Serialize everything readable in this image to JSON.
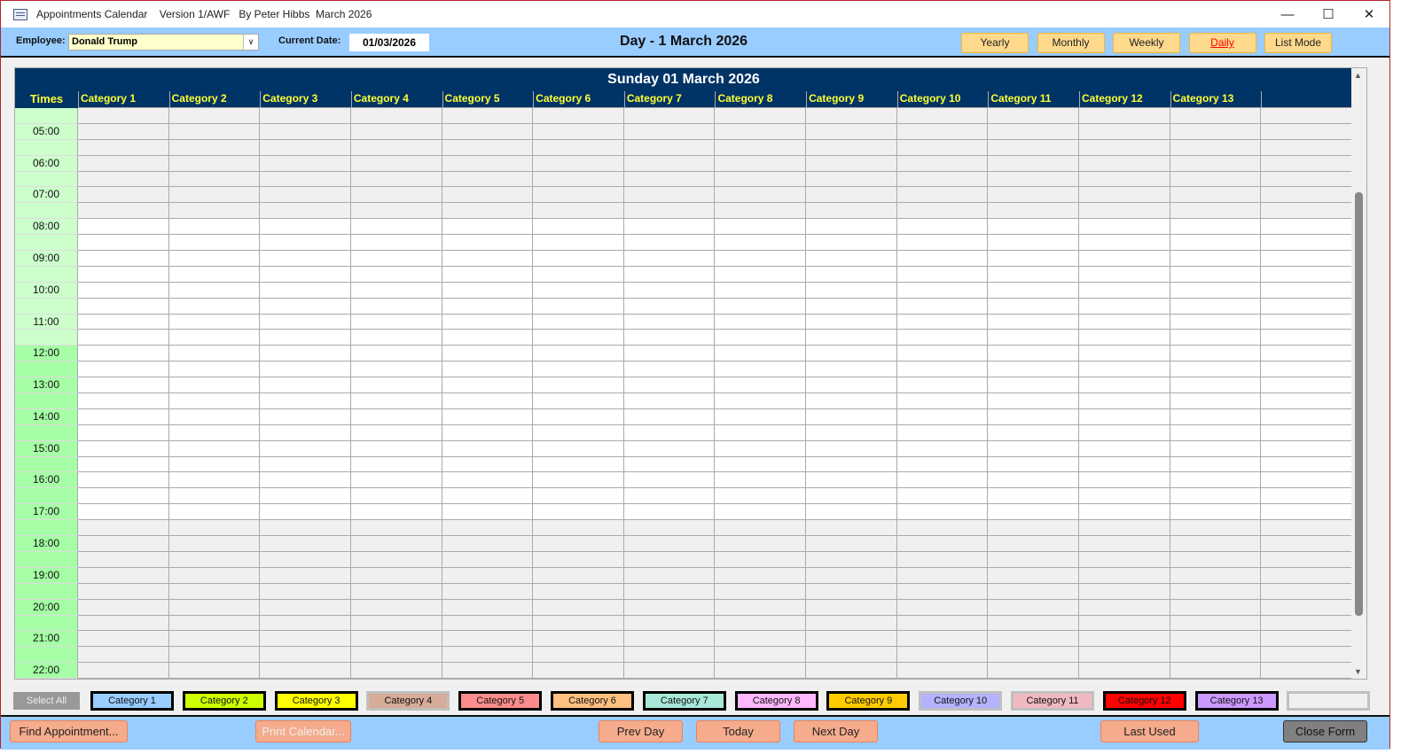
{
  "window": {
    "title": "Appointments Calendar    Version 1/AWF   By Peter Hibbs  March 2026",
    "minimize": "—",
    "maximize": "☐",
    "close": "✕"
  },
  "header": {
    "employee_label": "Employee:",
    "employee_value": "Donald Trump",
    "date_label": "Current Date:",
    "date_value": "01/03/2026",
    "day_title": "Day - 1 March 2026",
    "views": [
      {
        "label": "Yearly"
      },
      {
        "label": "Monthly"
      },
      {
        "label": "Weekly"
      },
      {
        "label": "Daily",
        "active": true
      },
      {
        "label": "List Mode"
      }
    ],
    "active_color": "#ff0000"
  },
  "grid": {
    "date_title": "Sunday  01 March 2026",
    "times_header": "Times",
    "categories": [
      "Category 1",
      "Category 2",
      "Category 3",
      "Category 4",
      "Category 5",
      "Category 6",
      "Category 7",
      "Category 8",
      "Category 9",
      "Category 10",
      "Category 11",
      "Category 12",
      "Category 13",
      ""
    ],
    "times": [
      "",
      "05:00",
      "",
      "06:00",
      "",
      "07:00",
      "",
      "08:00",
      "",
      "09:00",
      "",
      "10:00",
      "",
      "11:00",
      "",
      "12:00",
      "",
      "13:00",
      "",
      "14:00",
      "",
      "15:00",
      "",
      "16:00",
      "",
      "17:00",
      "",
      "18:00",
      "",
      "19:00",
      "",
      "20:00",
      "",
      "21:00",
      "",
      "22:00"
    ],
    "work_start": "08:00",
    "work_end": "17:30",
    "morning_color": "#ccffcc",
    "afternoon_color": "#a6ffa6"
  },
  "legend": {
    "select_all": "Select All",
    "items": [
      {
        "label": "Category 1",
        "color": "#99ccff",
        "selected": true
      },
      {
        "label": "Category 2",
        "color": "#ccff00",
        "selected": true
      },
      {
        "label": "Category 3",
        "color": "#ffff00",
        "selected": true
      },
      {
        "label": "Category 4",
        "color": "#d6ac98",
        "selected": false
      },
      {
        "label": "Category 5",
        "color": "#ff8c8c",
        "selected": true
      },
      {
        "label": "Category 6",
        "color": "#ffc080",
        "selected": true
      },
      {
        "label": "Category 7",
        "color": "#a8e8d8",
        "selected": true
      },
      {
        "label": "Category 8",
        "color": "#ffb8ff",
        "selected": true
      },
      {
        "label": "Category 9",
        "color": "#ffcc00",
        "selected": true
      },
      {
        "label": "Category 10",
        "color": "#b3b3ff",
        "selected": false
      },
      {
        "label": "Category 11",
        "color": "#f0b8c0",
        "selected": false
      },
      {
        "label": "Category 12",
        "color": "#ff0000",
        "selected": true
      },
      {
        "label": "Category 13",
        "color": "#cc99ff",
        "selected": true
      },
      {
        "label": "",
        "color": "#f0f0f0",
        "selected": false
      }
    ]
  },
  "footer": {
    "find": "Find Appointment...",
    "print": "Print Calendar...",
    "prev": "Prev Day",
    "today": "Today",
    "next": "Next Day",
    "last_used": "Last Used",
    "close": "Close Form"
  }
}
